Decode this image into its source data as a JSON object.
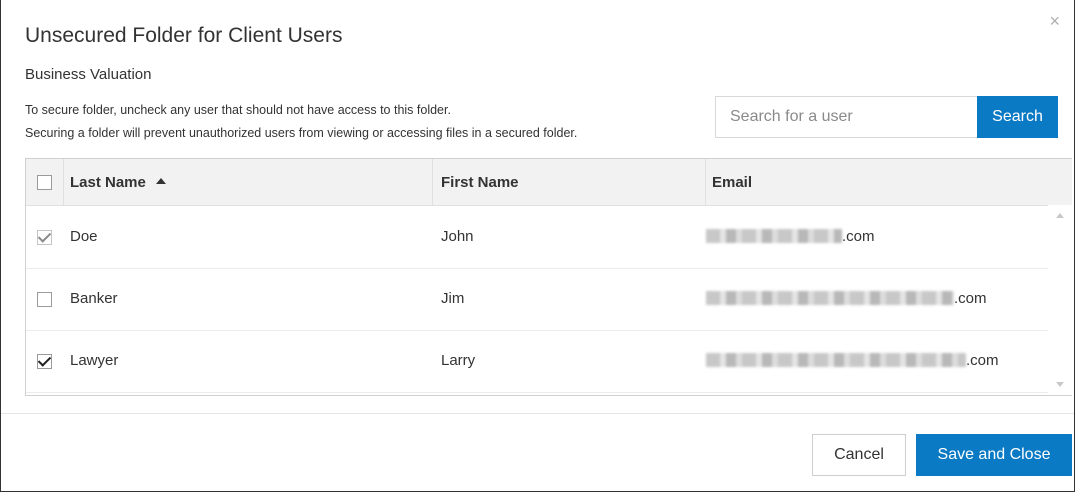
{
  "dialog": {
    "title": "Unsecured Folder for Client Users",
    "subtitle": "Business Valuation",
    "description_line1": "To secure folder, uncheck any user that should not have access to this folder.",
    "description_line2": "Securing a folder will prevent unauthorized users from viewing or accessing files in a secured folder.",
    "close_icon": "×"
  },
  "search": {
    "placeholder": "Search for a user",
    "value": "",
    "button_label": "Search"
  },
  "table": {
    "headers": {
      "last_name": "Last Name",
      "first_name": "First Name",
      "email": "Email"
    },
    "sort": {
      "column": "last_name",
      "direction": "ascending"
    },
    "select_all_checked": false,
    "rows": [
      {
        "last_name": "Doe",
        "first_name": "John",
        "email_suffix": ".com",
        "checked": true,
        "disabled": true
      },
      {
        "last_name": "Banker",
        "first_name": "Jim",
        "email_suffix": ".com",
        "checked": false,
        "disabled": false
      },
      {
        "last_name": "Lawyer",
        "first_name": "Larry",
        "email_suffix": ".com",
        "checked": true,
        "disabled": false
      }
    ]
  },
  "footer": {
    "cancel_label": "Cancel",
    "save_label": "Save and Close"
  },
  "colors": {
    "primary": "#0a7ac4",
    "header_bg": "#f2f2f2"
  }
}
